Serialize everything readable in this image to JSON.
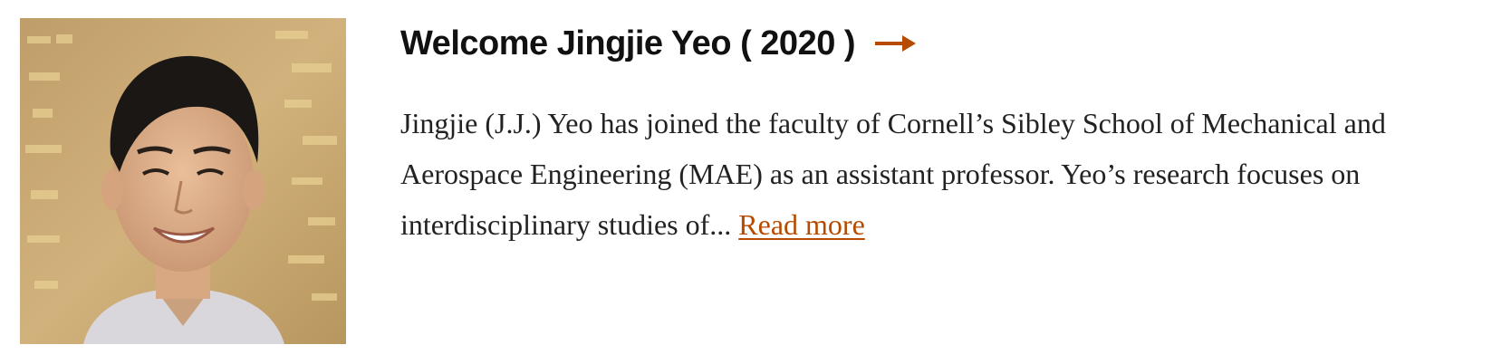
{
  "article": {
    "title": "Welcome Jingjie Yeo ( 2020 )",
    "excerpt_line1": "Jingjie (J.J.) Yeo has joined the faculty of Cornell’s Sibley School of Mechanical and",
    "excerpt_line2": "Aerospace Engineering (MAE) as an assistant professor. Yeo’s research focuses on",
    "excerpt_line3": "interdisciplinary studies of...",
    "read_more": "Read more",
    "arrow_icon": "right-arrow-icon",
    "photo_icon": "portrait-photo"
  },
  "colors": {
    "accent": "#b64b00",
    "title": "#111111",
    "body_text": "#222222",
    "background": "#ffffff"
  }
}
